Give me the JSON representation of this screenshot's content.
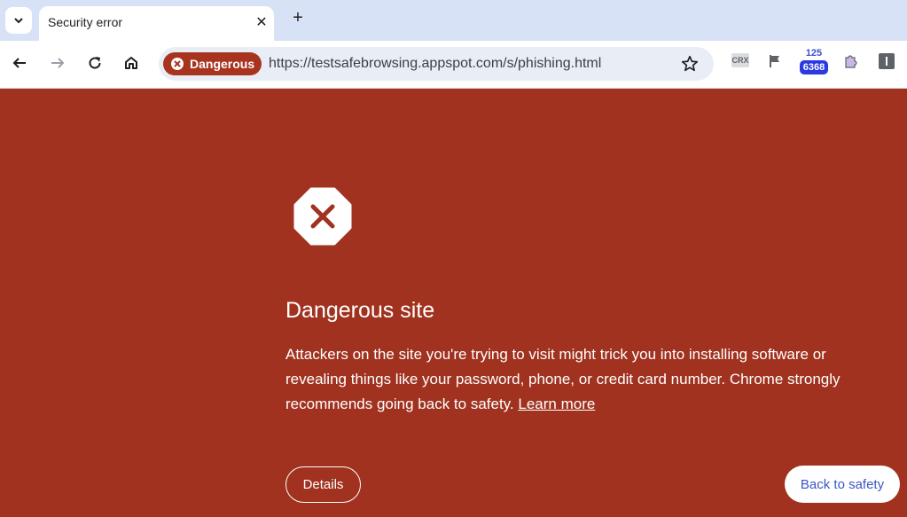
{
  "browser": {
    "tab": {
      "title": "Security error"
    },
    "omnibox": {
      "security_chip": "Dangerous",
      "url": "https://testsafebrowsing.appspot.com/s/phishing.html"
    },
    "extensions": {
      "crx_label": "CRX",
      "counter_top": "125",
      "counter_badge": "6368"
    }
  },
  "page": {
    "heading": "Dangerous site",
    "body_text": "Attackers on the site you're trying to visit might trick you into installing software or revealing things like your password, phone, or credit card number. Chrome strongly recommends going back to safety.",
    "learn_more": "Learn more",
    "details_button": "Details",
    "back_button": "Back to safety"
  },
  "colors": {
    "page_background": "#a0321f",
    "tab_strip": "#d7e2f6",
    "chip": "#a8341f",
    "back_button_text": "#3b56c4"
  }
}
